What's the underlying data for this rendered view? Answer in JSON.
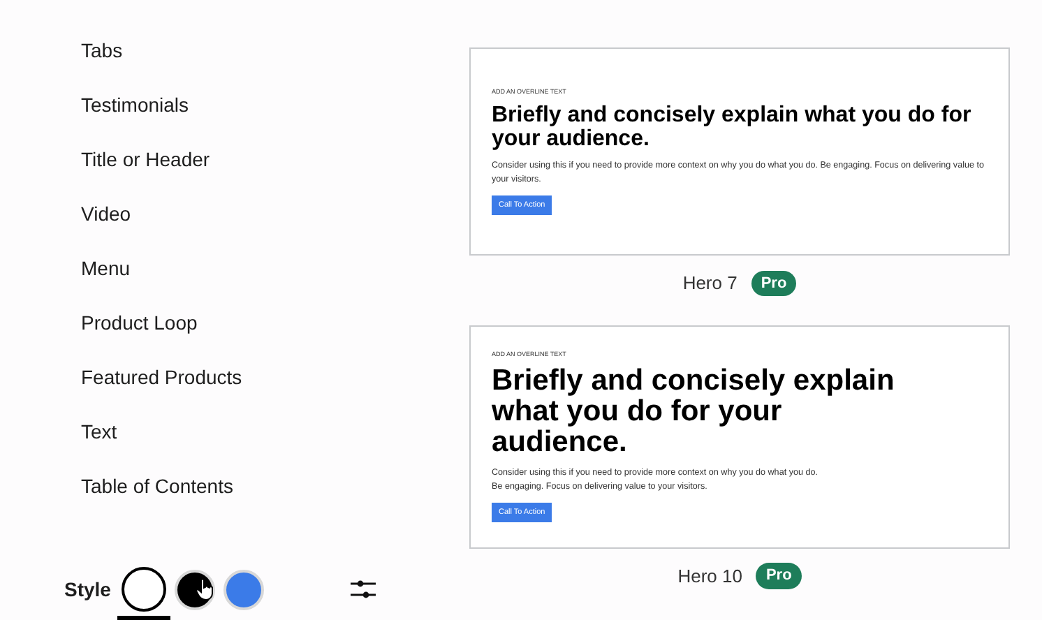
{
  "sidebar": {
    "items": [
      {
        "label": "Tabs"
      },
      {
        "label": "Testimonials"
      },
      {
        "label": "Title or Header"
      },
      {
        "label": "Video"
      },
      {
        "label": "Menu"
      },
      {
        "label": "Product Loop"
      },
      {
        "label": "Featured Products"
      },
      {
        "label": "Text"
      },
      {
        "label": "Table of Contents"
      }
    ]
  },
  "templates": [
    {
      "kind": "standard",
      "overline": "ADD AN OVERLINE TEXT",
      "heading": "Briefly and concisely explain what you do for your audience.",
      "body": "Consider using this if you need to provide more context on why you do what you do. Be engaging. Focus on delivering value to your visitors.",
      "button": "Call To Action",
      "name": "Hero 7",
      "badge": "Pro"
    },
    {
      "kind": "large",
      "overline": "ADD AN OVERLINE TEXT",
      "heading": "Briefly and concisely explain what you do for your audience.",
      "body": "Consider using this if you need to provide more context on why you do what you do. Be engaging. Focus on delivering value to your visitors.",
      "button": "Call To Action",
      "name": "Hero 10",
      "badge": "Pro"
    }
  ],
  "style_bar": {
    "label": "Style",
    "swatches": [
      {
        "color": "#ffffff",
        "selected": true
      },
      {
        "color": "#000000",
        "selected": false
      },
      {
        "color": "#3b7be8",
        "selected": false
      }
    ]
  }
}
